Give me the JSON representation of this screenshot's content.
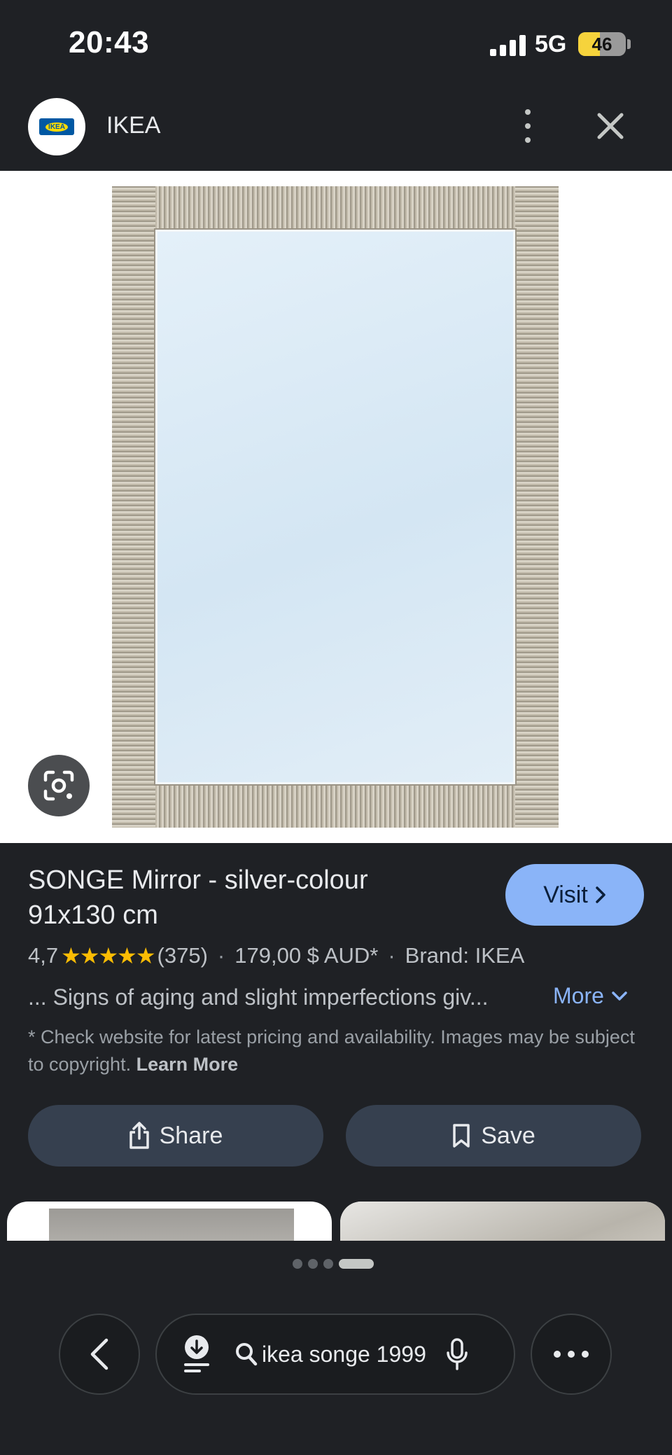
{
  "status_bar": {
    "time": "20:43",
    "network": "5G",
    "battery": "46",
    "battery_level": 0.46
  },
  "header": {
    "site_name": "IKEA",
    "logo_text": "IKEA"
  },
  "product": {
    "title": "SONGE Mirror - silver-colour 91x130 cm",
    "visit_label": "Visit",
    "rating": "4,7",
    "rating_value": 4.7,
    "review_count": "(375)",
    "price": "179,00 $ AUD*",
    "brand": "Brand: IKEA",
    "description": "... Signs of aging and slight imperfections giv...",
    "more_label": "More",
    "disclaimer": "* Check website for latest pricing and availability. Images may be subject to copyright.",
    "learn_more": "Learn More"
  },
  "actions": {
    "share_label": "Share",
    "save_label": "Save"
  },
  "search": {
    "query": "ikea songe 1999"
  },
  "pager": {
    "count": 4,
    "active_index": 3
  },
  "colors": {
    "accent": "#8ab4f8",
    "star": "#fbbc04",
    "background": "#1f2125",
    "button": "#36404f"
  }
}
